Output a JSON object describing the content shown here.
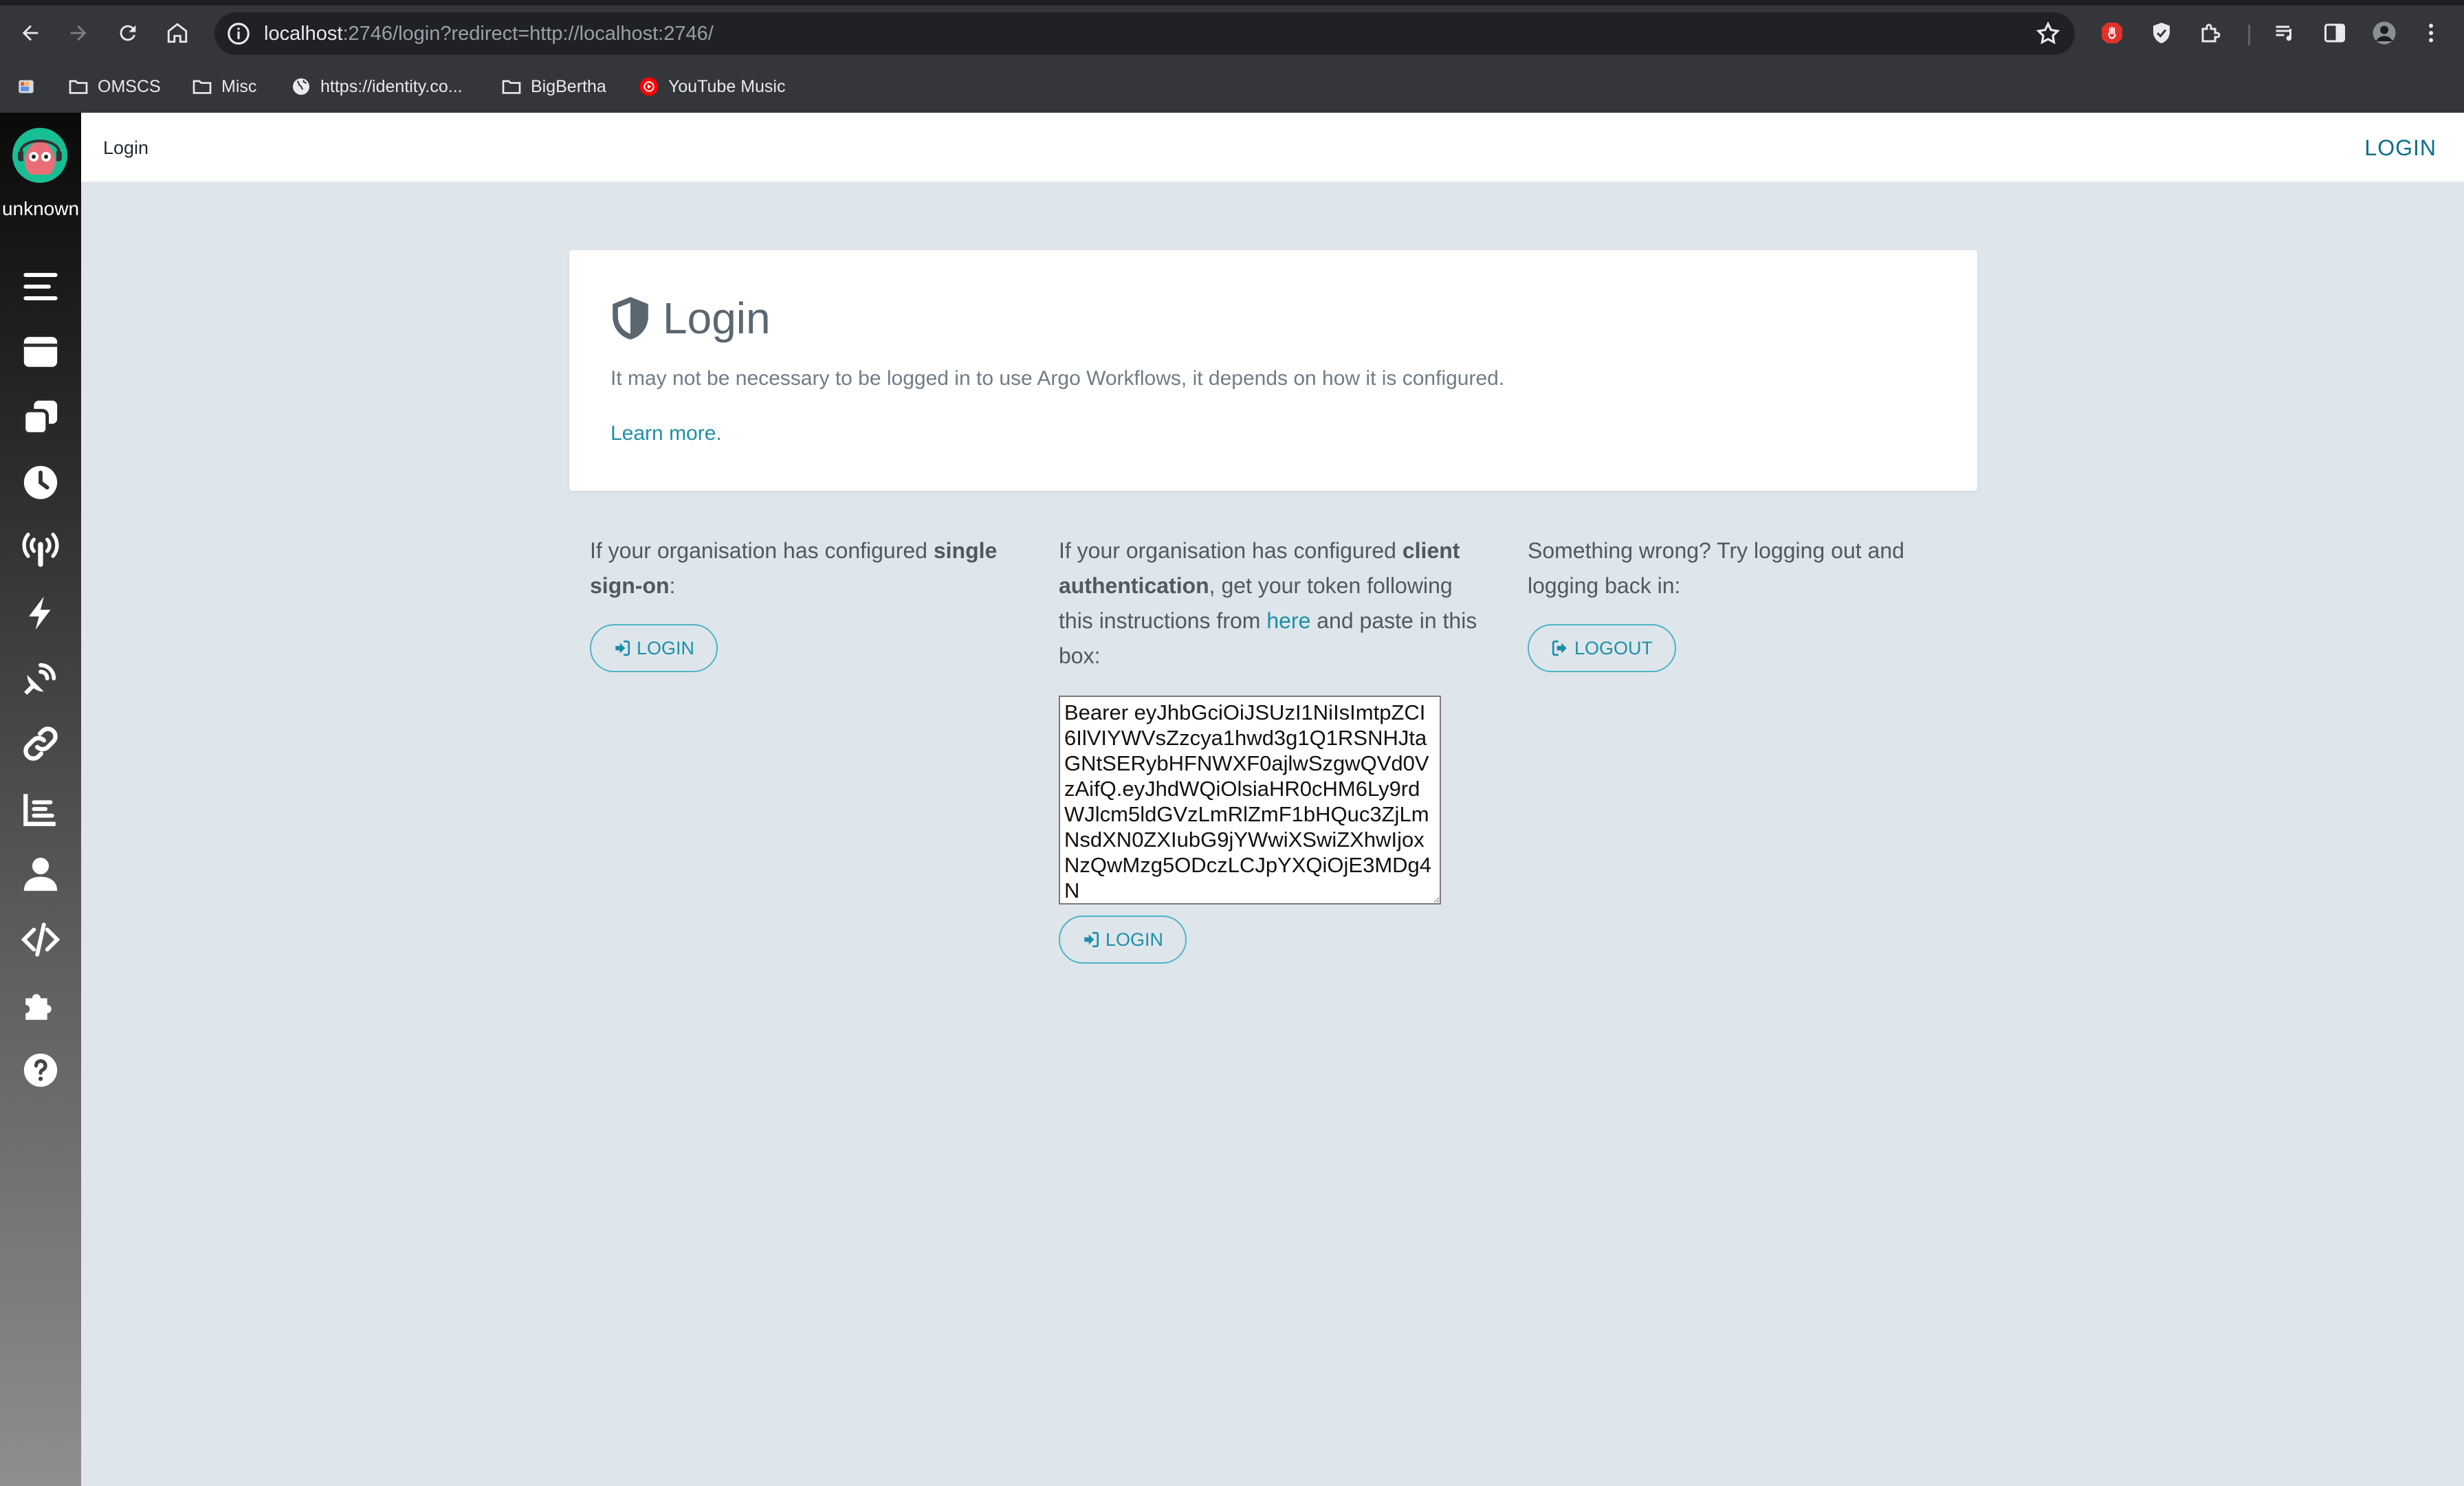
{
  "browser": {
    "url_host": "localhost",
    "url_rest": ":2746/login?redirect=http://localhost:2746/",
    "bookmarks": [
      {
        "label": "",
        "icon": "app-icon"
      },
      {
        "label": "OMSCS",
        "icon": "folder-icon"
      },
      {
        "label": "Misc",
        "icon": "folder-icon"
      },
      {
        "label": "https://identity.co...",
        "icon": "globe-icon"
      },
      {
        "label": "BigBertha",
        "icon": "folder-icon"
      },
      {
        "label": "YouTube Music",
        "icon": "youtube-music-icon"
      }
    ]
  },
  "sidebar": {
    "user": "unknown",
    "items": [
      {
        "icon": "menu-icon"
      },
      {
        "icon": "workflows-icon"
      },
      {
        "icon": "workflow-templates-icon"
      },
      {
        "icon": "cron-workflows-icon"
      },
      {
        "icon": "event-sources-icon"
      },
      {
        "icon": "sensors-icon"
      },
      {
        "icon": "event-flow-icon"
      },
      {
        "icon": "link-icon"
      },
      {
        "icon": "reports-icon"
      },
      {
        "icon": "user-icon"
      },
      {
        "icon": "api-docs-icon"
      },
      {
        "icon": "plugins-icon"
      },
      {
        "icon": "help-icon"
      }
    ]
  },
  "topbar": {
    "breadcrumb": "Login",
    "login_label": "LOGIN"
  },
  "card": {
    "title": "Login",
    "description": "It may not be necessary to be logged in to use Argo Workflows, it depends on how it is configured.",
    "learn_more": "Learn more."
  },
  "sso": {
    "text_before": "If your organisation has configured ",
    "text_bold": "single sign-on",
    "text_after": ":",
    "button": "LOGIN"
  },
  "client_auth": {
    "text_1": "If your organisation has configured ",
    "text_bold": "client authentication",
    "text_2": ", get your token following this instructions from ",
    "link": "here",
    "text_3": " and paste in this box:",
    "token_value": "Bearer eyJhbGciOiJSUzI1NiIsImtpZCI6IlVIYWVsZzcya1hwd3g1Q1RSNHJtaGNtSERybHFNWXF0ajlwSzgwQVd0VzAifQ.eyJhdWQiOlsiaHR0cHM6Ly9rdWJlcm5ldGVzLmRlZmF1bHQuc3ZjLmNsdXN0ZXIubG9jYWwiXSwiZXhwIjoxNzQwMzg5ODczLCJpYXQiOjE3MDg4N",
    "button": "LOGIN"
  },
  "logout": {
    "text": "Something wrong? Try logging out and logging back in:",
    "button": "LOGOUT"
  }
}
